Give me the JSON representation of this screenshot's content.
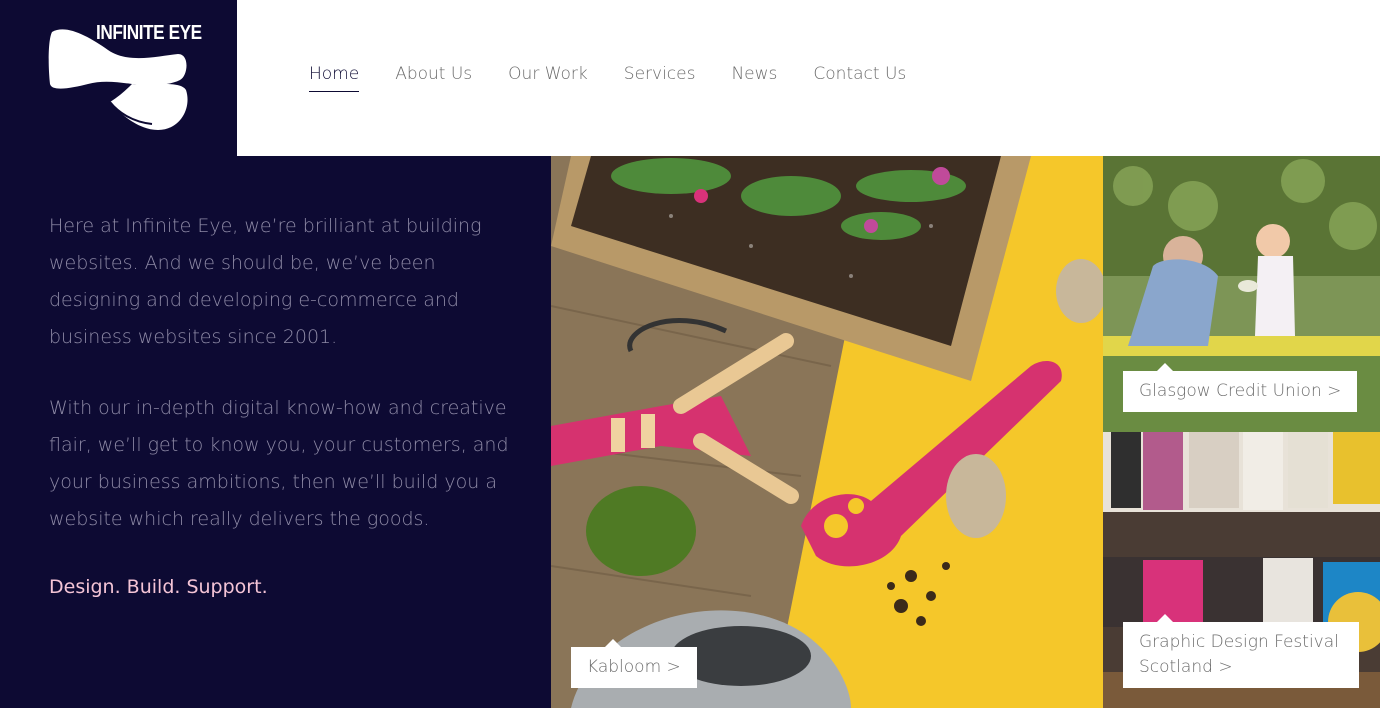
{
  "brand": {
    "name": "INFINITE EYE"
  },
  "nav": {
    "items": [
      {
        "label": "Home",
        "active": true
      },
      {
        "label": "About Us"
      },
      {
        "label": "Our Work"
      },
      {
        "label": "Services"
      },
      {
        "label": "News"
      },
      {
        "label": "Contact Us"
      }
    ]
  },
  "intro": {
    "paragraphs": [
      "Here at Infinite Eye, we’re brilliant at building websites. And we should be, we’ve been designing and developing e-commerce and business websites since 2001.",
      "With our in-depth digital know-how and creative flair, we’ll get to know you, your customers, and your business ambitions, then we’ll build you a website which really delivers the goods."
    ],
    "tagline": "Design. Build. Support."
  },
  "tiles": {
    "main": {
      "caption": "Kabloom >"
    },
    "gcu": {
      "caption": "Glasgow Credit Union >"
    },
    "gdf": {
      "caption": "Graphic Design Festival Scotland >"
    }
  },
  "colors": {
    "navy": "#0d0a33",
    "tagline": "#f4c4d6",
    "body_text": "#8e8aa6",
    "yellow": "#f5c72a",
    "magenta": "#d6326f"
  }
}
